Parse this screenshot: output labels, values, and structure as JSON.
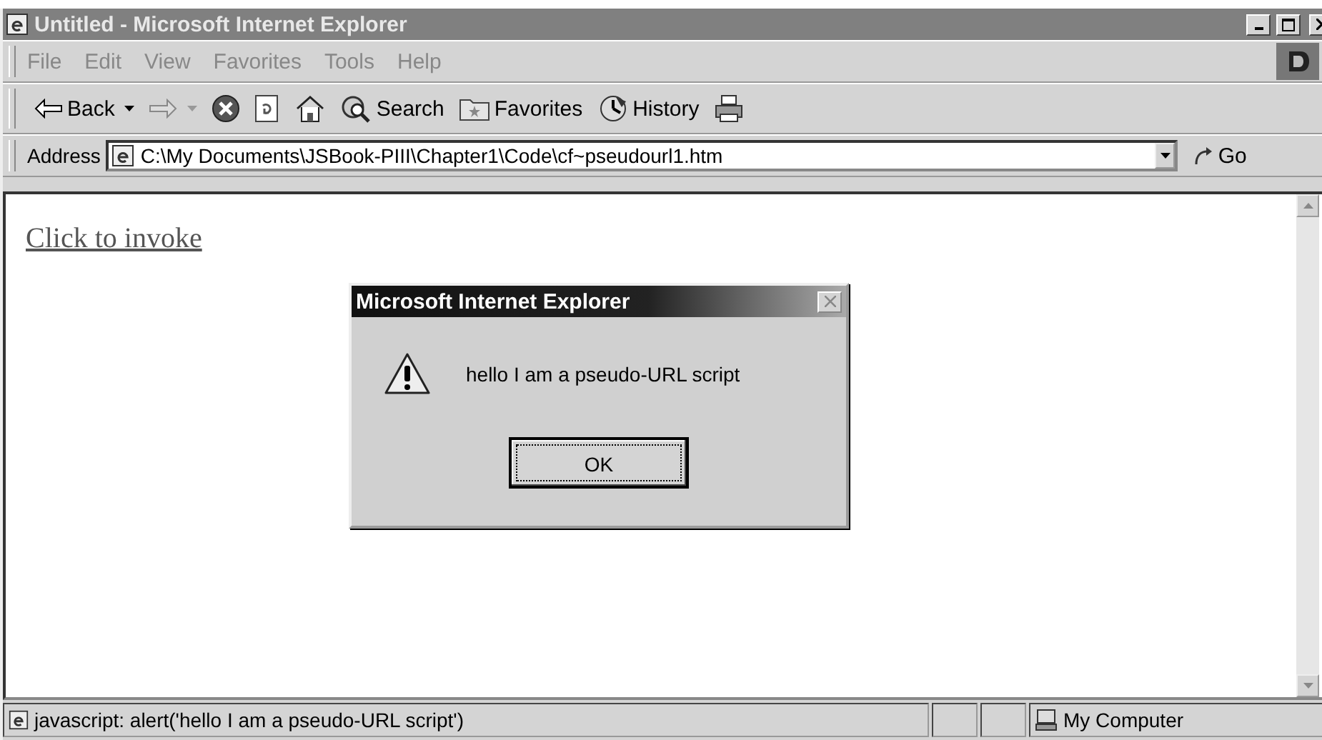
{
  "window": {
    "title": "Untitled - Microsoft Internet Explorer"
  },
  "menu": [
    "File",
    "Edit",
    "View",
    "Favorites",
    "Tools",
    "Help"
  ],
  "toolbar": [
    {
      "kind": "back",
      "label": "Back",
      "disabled": false
    },
    {
      "kind": "forward",
      "disabled": true
    },
    {
      "kind": "stop"
    },
    {
      "kind": "refresh"
    },
    {
      "kind": "home"
    },
    {
      "kind": "search",
      "label": "Search"
    },
    {
      "kind": "favorites",
      "label": "Favorites"
    },
    {
      "kind": "history",
      "label": "History"
    },
    {
      "kind": "print"
    }
  ],
  "address": {
    "label": "Address",
    "value": "C:\\My Documents\\JSBook-PIII\\Chapter1\\Code\\cf~pseudourl1.htm",
    "go": "Go"
  },
  "page": {
    "link": "Click to invoke"
  },
  "dialog": {
    "title": "Microsoft Internet Explorer",
    "message": "hello I am a pseudo-URL script",
    "button": "OK"
  },
  "status_bar": {
    "text": "javascript: alert('hello I am a pseudo-URL script')",
    "zone": "My Computer"
  }
}
